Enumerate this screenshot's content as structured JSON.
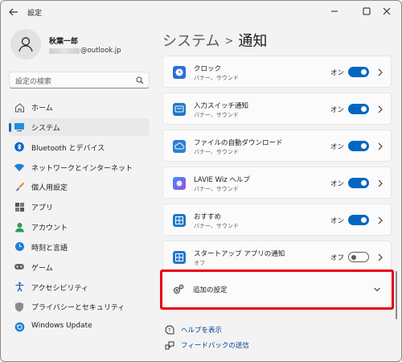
{
  "window": {
    "title": "設定",
    "controls": {
      "minimize_icon": "minimize-icon",
      "maximize_icon": "maximize-icon",
      "close_icon": "close-icon"
    }
  },
  "profile": {
    "name": "秋葉一郎",
    "email_suffix": "@outlook.jp"
  },
  "search": {
    "placeholder": "設定の検索"
  },
  "sidebar": {
    "items": [
      {
        "label": "ホーム",
        "icon": "home-icon",
        "selected": false
      },
      {
        "label": "システム",
        "icon": "system-display-icon",
        "selected": true
      },
      {
        "label": "Bluetooth とデバイス",
        "icon": "bluetooth-icon",
        "selected": false
      },
      {
        "label": "ネットワークとインターネット",
        "icon": "wifi-icon",
        "selected": false
      },
      {
        "label": "個人用設定",
        "icon": "brush-icon",
        "selected": false
      },
      {
        "label": "アプリ",
        "icon": "apps-icon",
        "selected": false
      },
      {
        "label": "アカウント",
        "icon": "account-icon",
        "selected": false
      },
      {
        "label": "時刻と言語",
        "icon": "time-language-icon",
        "selected": false
      },
      {
        "label": "ゲーム",
        "icon": "gamepad-icon",
        "selected": false
      },
      {
        "label": "アクセシビリティ",
        "icon": "accessibility-icon",
        "selected": false
      },
      {
        "label": "プライバシーとセキュリティ",
        "icon": "shield-icon",
        "selected": false
      },
      {
        "label": "Windows Update",
        "icon": "windows-update-icon",
        "selected": false
      }
    ]
  },
  "breadcrumb": {
    "parent": "システム",
    "separator": ">",
    "current": "通知"
  },
  "apps": [
    {
      "title": "クロック",
      "subtitle": "バナー、サウンド",
      "toggle_label": "オン",
      "on": true,
      "icon": "clock-app-icon",
      "color": "#2b6fd6"
    },
    {
      "title": "入力スイッチ通知",
      "subtitle": "バナー、サウンド",
      "toggle_label": "オン",
      "on": true,
      "icon": "input-switch-app-icon",
      "color": "#1f78c8"
    },
    {
      "title": "ファイルの自動ダウンロード",
      "subtitle": "バナー、サウンド",
      "toggle_label": "オン",
      "on": true,
      "icon": "cloud-download-app-icon",
      "color": "#2a7fd4"
    },
    {
      "title": "LAVIE Wiz ヘルプ",
      "subtitle": "バナー、サウンド",
      "toggle_label": "オン",
      "on": true,
      "icon": "lavie-wiz-app-icon",
      "color": "#6a4fd8"
    },
    {
      "title": "おすすめ",
      "subtitle": "バナー、サウンド",
      "toggle_label": "オン",
      "on": true,
      "icon": "recommend-app-icon",
      "color": "#1f78c8"
    },
    {
      "title": "スタートアップ アプリの通知",
      "subtitle": "オフ",
      "toggle_label": "オフ",
      "on": false,
      "icon": "startup-app-icon",
      "color": "#1f78c8"
    }
  ],
  "additional_settings": {
    "label": "追加の設定",
    "icon": "gear-icon",
    "expand_icon": "chevron-down-icon"
  },
  "links": [
    {
      "label": "ヘルプを表示",
      "icon": "help-icon"
    },
    {
      "label": "フィードバックの送信",
      "icon": "feedback-icon"
    }
  ],
  "colors": {
    "accent": "#0067c0",
    "highlight": "#e60012",
    "link": "#003e92"
  }
}
